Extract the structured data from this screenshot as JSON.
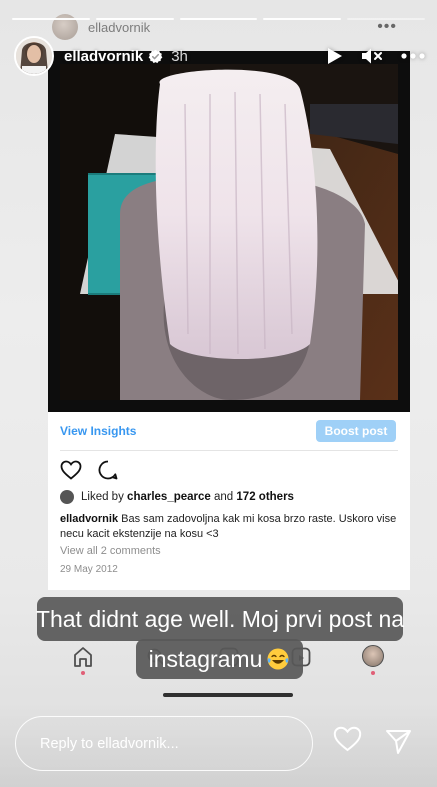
{
  "story": {
    "progress_total": 5,
    "progress_current": 5,
    "username": "elladvornik",
    "time": "3h",
    "ghost_username": "elladvornik",
    "icons": {
      "verified": "verified-badge-icon",
      "play": "play-icon",
      "mute": "mute-icon",
      "more": "more-icon"
    }
  },
  "post": {
    "view_insights": "View Insights",
    "boost_post": "Boost post",
    "liked_by_prefix": "Liked by ",
    "liked_by_user": "charles_pearce",
    "liked_by_and": " and ",
    "liked_by_count": "172 others",
    "caption_user": "elladvornik",
    "caption_text": "Bas sam zadovoljna kak mi kosa brzo raste. Uskoro vise necu kacit ekstenzije na kosu <3",
    "view_comments": "View all 2 comments",
    "date": "29 May 2012"
  },
  "overlay": {
    "line1": "That didnt age well. Moj prvi post na",
    "line2": "instagramu",
    "emoji": "laughing-tears-emoji"
  },
  "footer": {
    "reply_placeholder": "Reply to elladvornik..."
  },
  "colors": {
    "link_blue": "#3897f0",
    "boost_bg": "#9fd0f7"
  }
}
